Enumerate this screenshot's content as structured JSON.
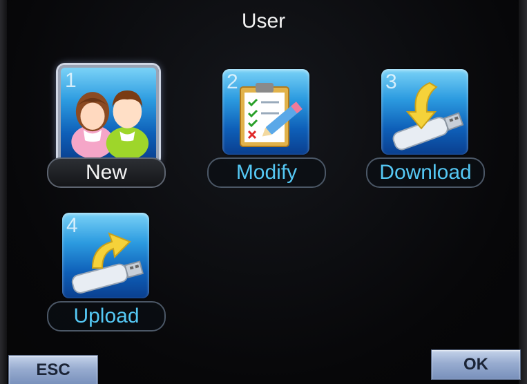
{
  "screen": {
    "title": "User"
  },
  "tiles": [
    {
      "number": "1",
      "label": "New",
      "icon": "users-icon",
      "selected": true
    },
    {
      "number": "2",
      "label": "Modify",
      "icon": "clipboard-edit-icon",
      "selected": false
    },
    {
      "number": "3",
      "label": "Download",
      "icon": "usb-download-icon",
      "selected": false
    },
    {
      "number": "4",
      "label": "Upload",
      "icon": "usb-upload-icon",
      "selected": false
    }
  ],
  "buttons": {
    "esc_label": "ESC",
    "ok_label": "OK"
  },
  "colors": {
    "label_text": "#55c8f4",
    "tile_blue": "#2c9be0",
    "button_blue": "#98acd0"
  }
}
